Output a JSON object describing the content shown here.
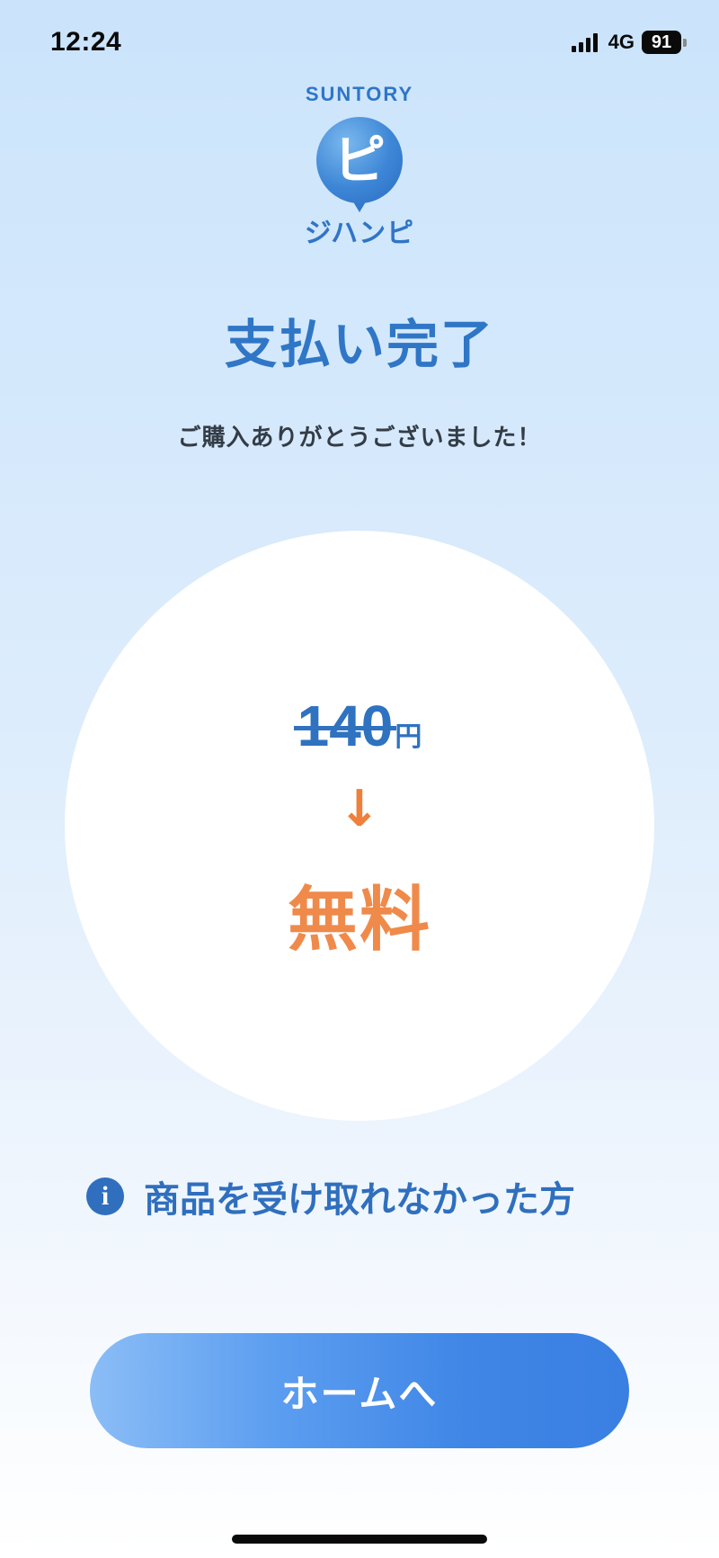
{
  "status_bar": {
    "time": "12:24",
    "network": "4G",
    "battery": "91"
  },
  "logo": {
    "brand": "SUNTORY",
    "glyph": "ピ",
    "name": "ジハンピ"
  },
  "page": {
    "title": "支払い完了",
    "thanks": "ご購入ありがとうございました！"
  },
  "price": {
    "original_amount": "140",
    "currency_unit": "円",
    "arrow": "↓",
    "result": "無料"
  },
  "help": {
    "label": "商品を受け取れなかった方"
  },
  "actions": {
    "home_label": "ホームへ"
  },
  "colors": {
    "primary_blue": "#2f76c6",
    "accent_orange": "#ef8a4a"
  },
  "icons": {
    "signal": "signal-icon",
    "battery": "battery-icon",
    "info": "info-icon",
    "arrow": "arrow-down-icon"
  }
}
